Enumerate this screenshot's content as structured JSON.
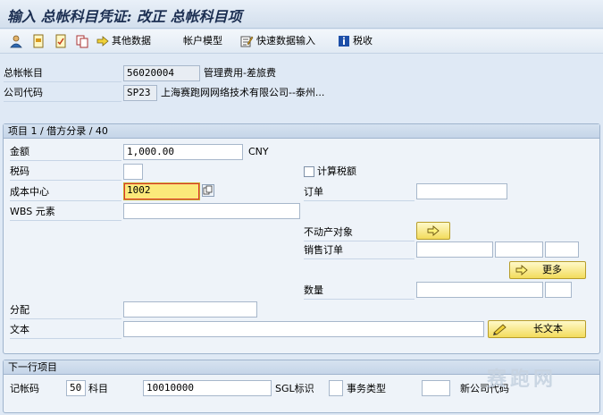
{
  "window": {
    "title": "输入 总帐科目凭证: 改正 总帐科目项"
  },
  "toolbar": {
    "other_data": "其他数据",
    "account_model": "帐户模型",
    "fast_entry": "快速数据输入",
    "tax": "税收"
  },
  "header": {
    "gl_account_label": "总帐帐目",
    "gl_account_value": "56020004",
    "gl_account_desc": "管理费用-差旅费",
    "company_code_label": "公司代码",
    "company_code_value": "SP23",
    "company_code_desc": "上海赛跑网网络技术有限公司--泰州..."
  },
  "item": {
    "panel_title": "项目 1 / 借方分录 / 40",
    "amount_label": "金额",
    "amount_value": "1,000.00",
    "currency": "CNY",
    "tax_code_label": "税码",
    "tax_code_value": "",
    "calc_tax_label": "计算税额",
    "cost_center_label": "成本中心",
    "cost_center_value": "1002",
    "order_label": "订单",
    "order_value": "",
    "wbs_label": "WBS 元素",
    "wbs_value": "",
    "real_estate_label": "不动产对象",
    "sales_order_label": "销售订单",
    "more_button": "更多",
    "quantity_label": "数量",
    "assignment_label": "分配",
    "assignment_value": "",
    "text_label": "文本",
    "text_value": "",
    "long_text_button": "长文本"
  },
  "next_item": {
    "panel_title": "下一行项目",
    "posting_key_label": "记帐码",
    "posting_key_value": "50",
    "account_label": "科目",
    "account_value": "10010000",
    "sgl_label": "SGL标识",
    "trans_type_label": "事务类型",
    "new_company_label": "新公司代码"
  },
  "watermark": "赛跑网"
}
